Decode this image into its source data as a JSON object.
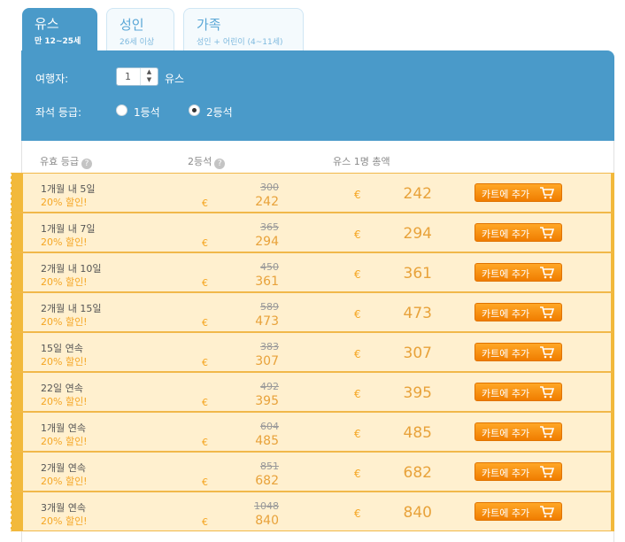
{
  "tabs": [
    {
      "title": "유스",
      "sub": "만 12~25세"
    },
    {
      "title": "성인",
      "sub": "26세 이상"
    },
    {
      "title": "가족",
      "sub": "성인 + 어린이 (4~11세)"
    }
  ],
  "form": {
    "travelers_label": "여행자:",
    "travelers_count": "1",
    "travelers_unit": "유스",
    "class_label": "좌석 등급:",
    "class_options": [
      "1등석",
      "2등석"
    ],
    "class_selected": "2등석"
  },
  "table": {
    "headers": [
      "유효 등급",
      "2등석",
      "유스 1명 총액"
    ],
    "currency": "€",
    "cart_label": "카트에 추가",
    "discount_label": "20% 할인!",
    "rows": [
      {
        "name": "1개월 내 5일",
        "old": "300",
        "price": "242",
        "total": "242"
      },
      {
        "name": "1개월 내 7일",
        "old": "365",
        "price": "294",
        "total": "294"
      },
      {
        "name": "2개월 내 10일",
        "old": "450",
        "price": "361",
        "total": "361"
      },
      {
        "name": "2개월 내 15일",
        "old": "589",
        "price": "473",
        "total": "473"
      },
      {
        "name": "15일 연속",
        "old": "383",
        "price": "307",
        "total": "307"
      },
      {
        "name": "22일 연속",
        "old": "492",
        "price": "395",
        "total": "395"
      },
      {
        "name": "1개월 연속",
        "old": "604",
        "price": "485",
        "total": "485"
      },
      {
        "name": "2개월 연속",
        "old": "851",
        "price": "682",
        "total": "682"
      },
      {
        "name": "3개월 연속",
        "old": "1048",
        "price": "840",
        "total": "840"
      }
    ]
  },
  "colors": {
    "accent": "#4a9ac9",
    "row_bg": "#fff0cf",
    "orange": "#f5a623"
  },
  "icons": {
    "help": "question-circle-icon",
    "cart": "shopping-cart-icon",
    "stepper": "stepper-arrows-icon"
  }
}
